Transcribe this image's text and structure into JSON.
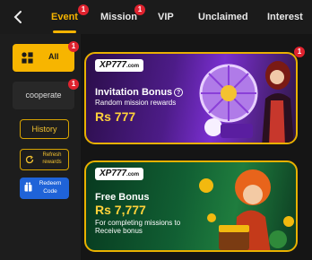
{
  "tabs": [
    {
      "label": "Event",
      "active": true,
      "badge": "1"
    },
    {
      "label": "Mission",
      "active": false,
      "badge": "1"
    },
    {
      "label": "VIP",
      "active": false,
      "badge": ""
    },
    {
      "label": "Unclaimed",
      "active": false,
      "badge": ""
    },
    {
      "label": "Interest",
      "active": false,
      "badge": ""
    }
  ],
  "sidebar": {
    "categories": [
      {
        "label": "All",
        "active": true,
        "badge": "1"
      },
      {
        "label": "cooperate",
        "active": false,
        "badge": "1"
      }
    ],
    "history_label": "History",
    "refresh_label": "Refresh rewards",
    "redeem_label": "Redeem Code"
  },
  "promos": [
    {
      "logo": "XP777",
      "logo_domain": ".com",
      "title": "Invitation Bonus",
      "subtitle": "Random mission rewards",
      "amount": "Rs 777",
      "badge": "1"
    },
    {
      "logo": "XP777",
      "logo_domain": ".com",
      "title": "Free Bonus",
      "amount": "Rs 7,777",
      "subtitle": "For completing missions to Receive bonus"
    }
  ],
  "colors": {
    "accent": "#f5b301",
    "badge": "#e0232f",
    "redeem": "#1f63d8"
  }
}
